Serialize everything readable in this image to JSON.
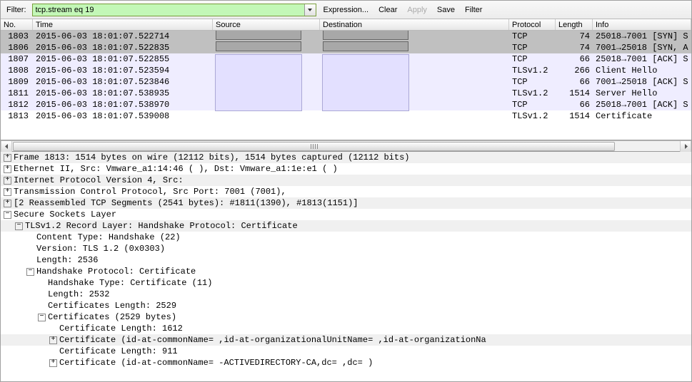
{
  "toolbar": {
    "filter_label": "Filter:",
    "filter_value": "tcp.stream eq 19",
    "btn_expression": "Expression...",
    "btn_clear": "Clear",
    "btn_apply": "Apply",
    "btn_save": "Save",
    "btn_filter": "Filter"
  },
  "columns": {
    "no": "No.",
    "time": "Time",
    "source": "Source",
    "destination": "Destination",
    "protocol": "Protocol",
    "length": "Length",
    "info": "Info"
  },
  "packets": [
    {
      "no": "1803",
      "time": "2015-06-03 18:01:07.522714",
      "protocol": "TCP",
      "length": "74",
      "info": "25018→7001 [SYN] S",
      "cls": "row-sel"
    },
    {
      "no": "1806",
      "time": "2015-06-03 18:01:07.522835",
      "protocol": "TCP",
      "length": "74",
      "info": "7001→25018 [SYN, A",
      "cls": "row-sel"
    },
    {
      "no": "1807",
      "time": "2015-06-03 18:01:07.522855",
      "protocol": "TCP",
      "length": "66",
      "info": "25018→7001 [ACK] S",
      "cls": "row-tls"
    },
    {
      "no": "1808",
      "time": "2015-06-03 18:01:07.523594",
      "protocol": "TLSv1.2",
      "length": "266",
      "info": "Client Hello",
      "cls": "row-tls"
    },
    {
      "no": "1809",
      "time": "2015-06-03 18:01:07.523846",
      "protocol": "TCP",
      "length": "66",
      "info": "7001→25018 [ACK] S",
      "cls": "row-tls"
    },
    {
      "no": "1811",
      "time": "2015-06-03 18:01:07.538935",
      "protocol": "TLSv1.2",
      "length": "1514",
      "info": "Server Hello",
      "cls": "row-tls"
    },
    {
      "no": "1812",
      "time": "2015-06-03 18:01:07.538970",
      "protocol": "TCP",
      "length": "66",
      "info": "25018→7001 [ACK] S",
      "cls": "row-tls"
    },
    {
      "no": "1813",
      "time": "2015-06-03 18:01:07.539008",
      "protocol": "TLSv1.2",
      "length": "1514",
      "info": "Certificate",
      "cls": "row-tcp"
    }
  ],
  "tree": [
    {
      "indent": 0,
      "toggle": "+",
      "hl": true,
      "text": "Frame 1813: 1514 bytes on wire (12112 bits), 1514 bytes captured (12112 bits)"
    },
    {
      "indent": 0,
      "toggle": "+",
      "hl": false,
      "text": "Ethernet II, Src: Vmware_a1:14:46 (              ), Dst: Vmware_a1:1e:e1 (              )"
    },
    {
      "indent": 0,
      "toggle": "+",
      "hl": true,
      "text": "Internet Protocol Version 4, Src:"
    },
    {
      "indent": 0,
      "toggle": "+",
      "hl": false,
      "text": "Transmission Control Protocol, Src Port: 7001 (7001),"
    },
    {
      "indent": 0,
      "toggle": "+",
      "hl": true,
      "text": "[2 Reassembled TCP Segments (2541 bytes): #1811(1390), #1813(1151)]"
    },
    {
      "indent": 0,
      "toggle": "-",
      "hl": false,
      "text": "Secure Sockets Layer"
    },
    {
      "indent": 1,
      "toggle": "-",
      "hl": true,
      "text": "TLSv1.2 Record Layer: Handshake Protocol: Certificate"
    },
    {
      "indent": 2,
      "toggle": "",
      "hl": false,
      "text": "Content Type: Handshake (22)"
    },
    {
      "indent": 2,
      "toggle": "",
      "hl": false,
      "text": "Version: TLS 1.2 (0x0303)"
    },
    {
      "indent": 2,
      "toggle": "",
      "hl": false,
      "text": "Length: 2536"
    },
    {
      "indent": 2,
      "toggle": "-",
      "hl": false,
      "text": "Handshake Protocol: Certificate"
    },
    {
      "indent": 3,
      "toggle": "",
      "hl": false,
      "text": "Handshake Type: Certificate (11)"
    },
    {
      "indent": 3,
      "toggle": "",
      "hl": false,
      "text": "Length: 2532"
    },
    {
      "indent": 3,
      "toggle": "",
      "hl": false,
      "text": "Certificates Length: 2529"
    },
    {
      "indent": 3,
      "toggle": "-",
      "hl": false,
      "text": "Certificates (2529 bytes)"
    },
    {
      "indent": 4,
      "toggle": "",
      "hl": false,
      "text": "Certificate Length: 1612"
    },
    {
      "indent": 4,
      "toggle": "+",
      "hl": true,
      "text": "Certificate (id-at-commonName=                         ,id-at-organizationalUnitName=    ,id-at-organizationNa"
    },
    {
      "indent": 4,
      "toggle": "",
      "hl": false,
      "text": "Certificate Length: 911"
    },
    {
      "indent": 4,
      "toggle": "+",
      "hl": false,
      "text": "Certificate (id-at-commonName=        -ACTIVEDIRECTORY-CA,dc=        ,dc=     )"
    }
  ]
}
